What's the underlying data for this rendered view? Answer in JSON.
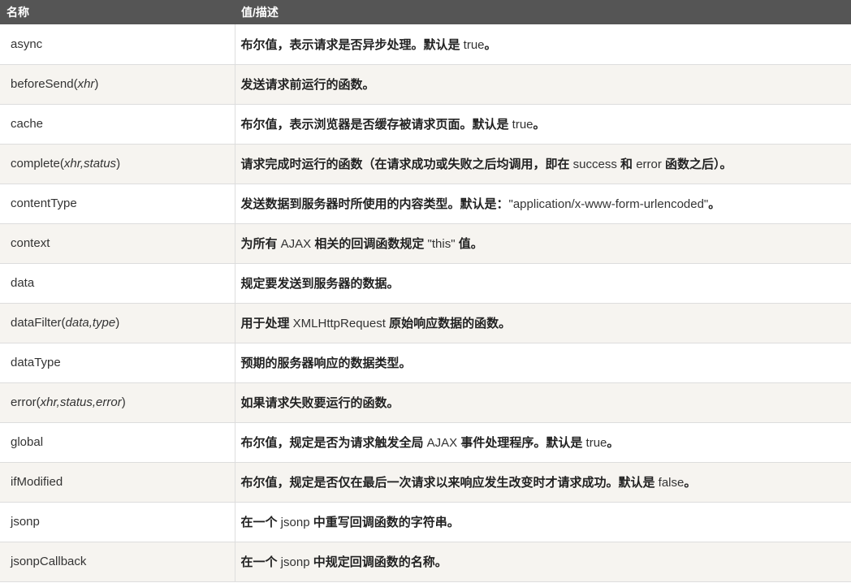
{
  "header": {
    "col_name": "名称",
    "col_desc": "值/描述"
  },
  "rows": [
    {
      "name": [
        {
          "t": "async"
        }
      ],
      "desc": [
        {
          "t": "布尔值，表示请求是否异步处理。默认是 "
        },
        {
          "t": "true",
          "lat": true
        },
        {
          "t": "。"
        }
      ]
    },
    {
      "name": [
        {
          "t": "beforeSend("
        },
        {
          "t": "xhr",
          "i": true
        },
        {
          "t": ")"
        }
      ],
      "desc": [
        {
          "t": "发送请求前运行的函数。"
        }
      ]
    },
    {
      "name": [
        {
          "t": "cache"
        }
      ],
      "desc": [
        {
          "t": "布尔值，表示浏览器是否缓存被请求页面。默认是 "
        },
        {
          "t": "true",
          "lat": true
        },
        {
          "t": "。"
        }
      ]
    },
    {
      "name": [
        {
          "t": "complete("
        },
        {
          "t": "xhr,status",
          "i": true
        },
        {
          "t": ")"
        }
      ],
      "desc": [
        {
          "t": "请求完成时运行的函数（在请求成功或失败之后均调用，即在 "
        },
        {
          "t": "success",
          "lat": true
        },
        {
          "t": " 和 "
        },
        {
          "t": "error",
          "lat": true
        },
        {
          "t": " 函数之后）。"
        }
      ]
    },
    {
      "name": [
        {
          "t": "contentType"
        }
      ],
      "desc": [
        {
          "t": "发送数据到服务器时所使用的内容类型。默认是："
        },
        {
          "t": "\"application/x-www-form-urlencoded\"",
          "lat": true
        },
        {
          "t": "。"
        }
      ]
    },
    {
      "name": [
        {
          "t": "context"
        }
      ],
      "desc": [
        {
          "t": "为所有 "
        },
        {
          "t": "AJAX",
          "lat": true
        },
        {
          "t": " 相关的回调函数规定 "
        },
        {
          "t": "\"this\"",
          "lat": true
        },
        {
          "t": " 值。"
        }
      ]
    },
    {
      "name": [
        {
          "t": "data"
        }
      ],
      "desc": [
        {
          "t": "规定要发送到服务器的数据。"
        }
      ]
    },
    {
      "name": [
        {
          "t": "dataFilter("
        },
        {
          "t": "data,type",
          "i": true
        },
        {
          "t": ")"
        }
      ],
      "desc": [
        {
          "t": "用于处理 "
        },
        {
          "t": "XMLHttpRequest",
          "lat": true
        },
        {
          "t": " 原始响应数据的函数。"
        }
      ]
    },
    {
      "name": [
        {
          "t": "dataType"
        }
      ],
      "desc": [
        {
          "t": "预期的服务器响应的数据类型。"
        }
      ]
    },
    {
      "name": [
        {
          "t": "error("
        },
        {
          "t": "xhr,status,error",
          "i": true
        },
        {
          "t": ")"
        }
      ],
      "desc": [
        {
          "t": "如果请求失败要运行的函数。"
        }
      ]
    },
    {
      "name": [
        {
          "t": "global"
        }
      ],
      "desc": [
        {
          "t": "布尔值，规定是否为请求触发全局 "
        },
        {
          "t": "AJAX",
          "lat": true
        },
        {
          "t": " 事件处理程序。默认是 "
        },
        {
          "t": "true",
          "lat": true
        },
        {
          "t": "。"
        }
      ]
    },
    {
      "name": [
        {
          "t": "ifModified"
        }
      ],
      "desc": [
        {
          "t": "布尔值，规定是否仅在最后一次请求以来响应发生改变时才请求成功。默认是 "
        },
        {
          "t": "false",
          "lat": true
        },
        {
          "t": "。"
        }
      ]
    },
    {
      "name": [
        {
          "t": "jsonp"
        }
      ],
      "desc": [
        {
          "t": "在一个 "
        },
        {
          "t": "jsonp",
          "lat": true
        },
        {
          "t": " 中重写回调函数的字符串。"
        }
      ]
    },
    {
      "name": [
        {
          "t": "jsonpCallback"
        }
      ],
      "desc": [
        {
          "t": "在一个 "
        },
        {
          "t": "jsonp",
          "lat": true
        },
        {
          "t": " 中规定回调函数的名称。"
        }
      ]
    }
  ]
}
